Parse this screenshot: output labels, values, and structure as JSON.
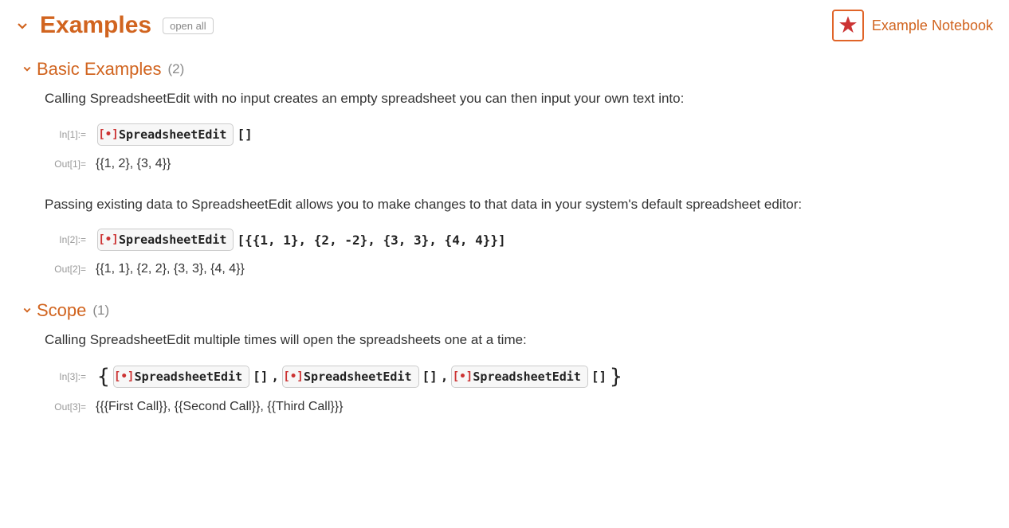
{
  "header": {
    "title": "Examples",
    "open_all": "open all",
    "example_notebook": "Example Notebook"
  },
  "sections": {
    "basic": {
      "title": "Basic Examples",
      "count": "(2)"
    },
    "scope": {
      "title": "Scope",
      "count": "(1)"
    }
  },
  "basic": {
    "p1": "Calling SpreadsheetEdit with no input creates an empty spreadsheet you can then input your own text into:",
    "in1_label": "In[1]:=",
    "in1_fn": "SpreadsheetEdit",
    "in1_tail": "[]",
    "out1_label": "Out[1]=",
    "out1": "{{1, 2}, {3, 4}}",
    "p2": "Passing existing data to SpreadsheetEdit allows you to make changes to that data in your system's default spreadsheet editor:",
    "in2_label": "In[2]:=",
    "in2_fn": "SpreadsheetEdit",
    "in2_tail": "[{{1, 1}, {2, -2}, {3, 3}, {4, 4}}]",
    "out2_label": "Out[2]=",
    "out2": "{{1, 1}, {2, 2}, {3, 3}, {4, 4}}"
  },
  "scope": {
    "p1": "Calling SpreadsheetEdit multiple times will open the spreadsheets one at a time:",
    "in3_label": "In[3]:=",
    "fn": "SpreadsheetEdit",
    "empty": "[]",
    "comma": ",",
    "out3_label": "Out[3]=",
    "out3": "{{{First Call}}, {{Second Call}}, {{Third Call}}}"
  }
}
